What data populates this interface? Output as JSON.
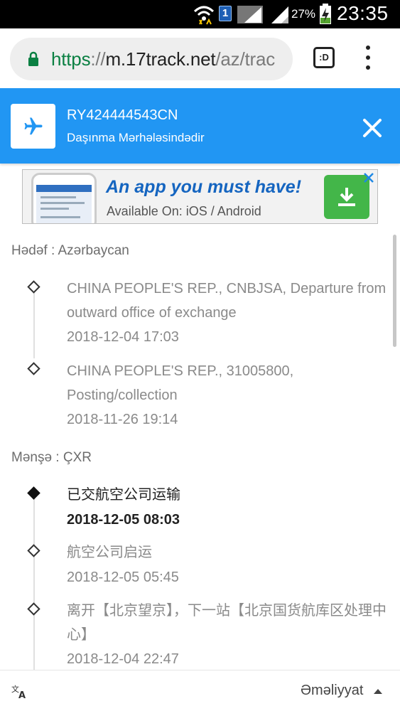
{
  "status_bar": {
    "sim_label": "1",
    "battery_pct": "27%",
    "time": "23:35",
    "icons": [
      "wifi-icon",
      "sim-icon",
      "signal-icon",
      "signal-icon",
      "battery-charging-icon"
    ]
  },
  "browser": {
    "url_scheme": "https",
    "url_sep": "://",
    "url_host": "m.17track.net",
    "url_path": "/az/trac",
    "tab_label": ":D",
    "icons": [
      "lock-icon",
      "tab-switcher-icon",
      "more-vert-icon"
    ]
  },
  "header": {
    "tracking_number": "RY424444543CN",
    "status": "Daşınma Mərhələsindədir",
    "bg_color": "#2196f3",
    "icons": [
      "airplane-icon",
      "close-icon"
    ]
  },
  "ad": {
    "title": "An app you must have!",
    "subtitle": "Available On: iOS / Android",
    "icons": [
      "app-screenshot",
      "download-icon",
      "ad-close-icon"
    ]
  },
  "destination": {
    "label": "Hədəf : Azərbaycan",
    "events": [
      {
        "text": "CHINA PEOPLE'S REP., CNBJSA, Departure from outward office of exchange",
        "time": "2018-12-04 17:03"
      },
      {
        "text": "CHINA PEOPLE'S REP., 31005800, Posting/collection",
        "time": "2018-11-26 19:14"
      }
    ]
  },
  "origin": {
    "label": "Mənşə : ÇXR",
    "events": [
      {
        "text": "已交航空公司运输",
        "time": "2018-12-05 08:03",
        "latest": true
      },
      {
        "text": "航空公司启运",
        "time": "2018-12-05 05:45"
      },
      {
        "text": "离开【北京望京】，下一站【北京国货航库区处理中心】",
        "time": "2018-12-04 22:47"
      }
    ]
  },
  "bottom": {
    "action_label": "Əməliyyat",
    "icons": [
      "translate-icon",
      "caret-up-icon"
    ]
  }
}
